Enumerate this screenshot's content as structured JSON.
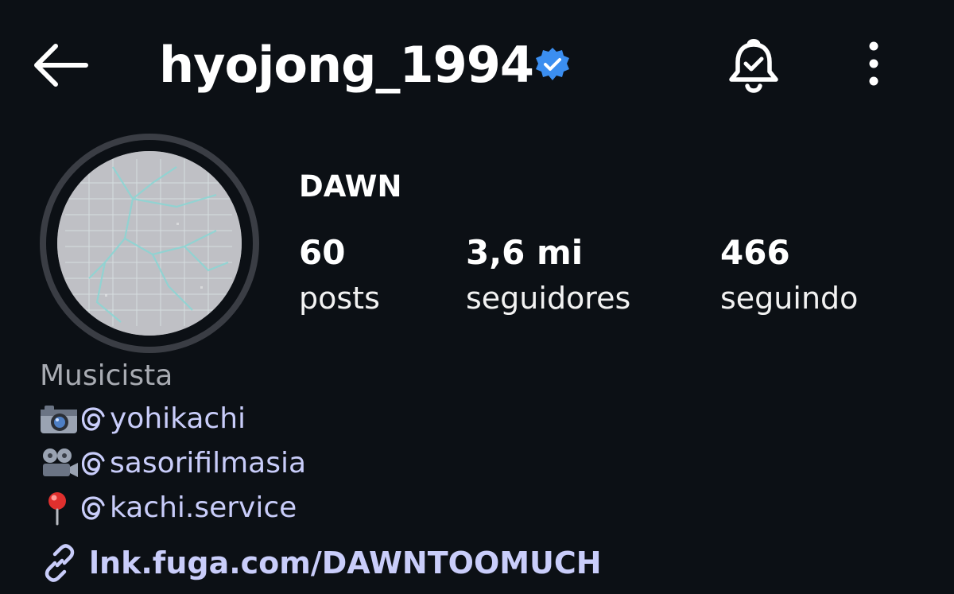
{
  "header": {
    "username": "hyojong_1994",
    "back_icon": "arrow-left-icon",
    "verified_icon": "verified-badge-icon",
    "bell_icon": "notification-bell-icon",
    "more_icon": "more-vertical-icon"
  },
  "profile": {
    "display_name": "DAWN",
    "stats": [
      {
        "value": "60",
        "label": "posts"
      },
      {
        "value": "3,6 mi",
        "label": "seguidores"
      },
      {
        "value": "466",
        "label": "seguindo"
      }
    ]
  },
  "bio": {
    "category": "Musicista",
    "lines": [
      {
        "emoji": "camera-icon",
        "mention": "yohikachi"
      },
      {
        "emoji": "film-projector-icon",
        "mention": "sasorifilmasia"
      },
      {
        "emoji": "pushpin-icon",
        "mention": "kachi.service"
      }
    ],
    "link": "lnk.fuga.com/DAWNTOOMUCH"
  },
  "colors": {
    "background": "#0c1015",
    "text": "#ffffff",
    "muted": "#a8abb2",
    "link": "#c9cdfa",
    "verified": "#3b8ef0"
  }
}
